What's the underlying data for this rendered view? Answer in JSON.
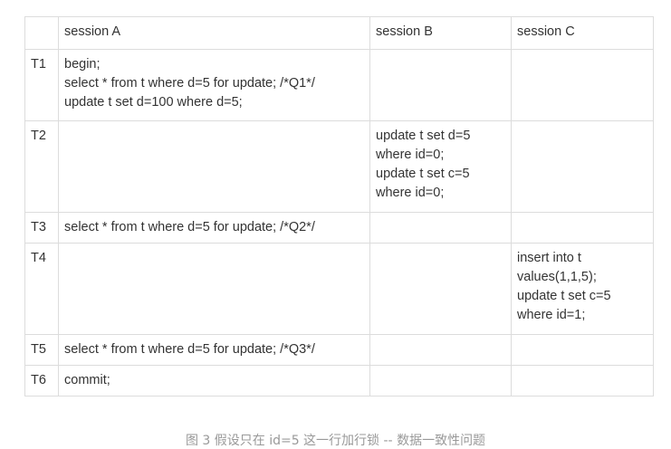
{
  "table": {
    "headers": [
      "",
      "session A",
      "session B",
      "session C"
    ],
    "rows": [
      {
        "time": "T1",
        "a": [
          "begin;",
          "select * from t where d=5 for update; /*Q1*/",
          "update t set d=100 where d=5;"
        ],
        "b": [],
        "c": []
      },
      {
        "time": "T2",
        "a": [],
        "b": [
          "update t set d=5",
          "where id=0;",
          "update t set c=5",
          "where id=0;"
        ],
        "c": []
      },
      {
        "time": "T3",
        "a": [
          "select * from t where d=5 for update; /*Q2*/"
        ],
        "b": [],
        "c": []
      },
      {
        "time": "T4",
        "a": [],
        "b": [],
        "c": [
          "insert into t",
          "values(1,1,5);",
          "update t set c=5",
          "where id=1;"
        ]
      },
      {
        "time": "T5",
        "a": [
          "select * from t where d=5 for update; /*Q3*/"
        ],
        "b": [],
        "c": []
      },
      {
        "time": "T6",
        "a": [
          "commit;"
        ],
        "b": [],
        "c": []
      }
    ]
  },
  "caption": "图 3 假设只在 id=5 这一行加行锁 -- 数据一致性问题",
  "colors": {
    "border": "#dcdcdc",
    "text": "#333333",
    "caption": "#999999"
  }
}
